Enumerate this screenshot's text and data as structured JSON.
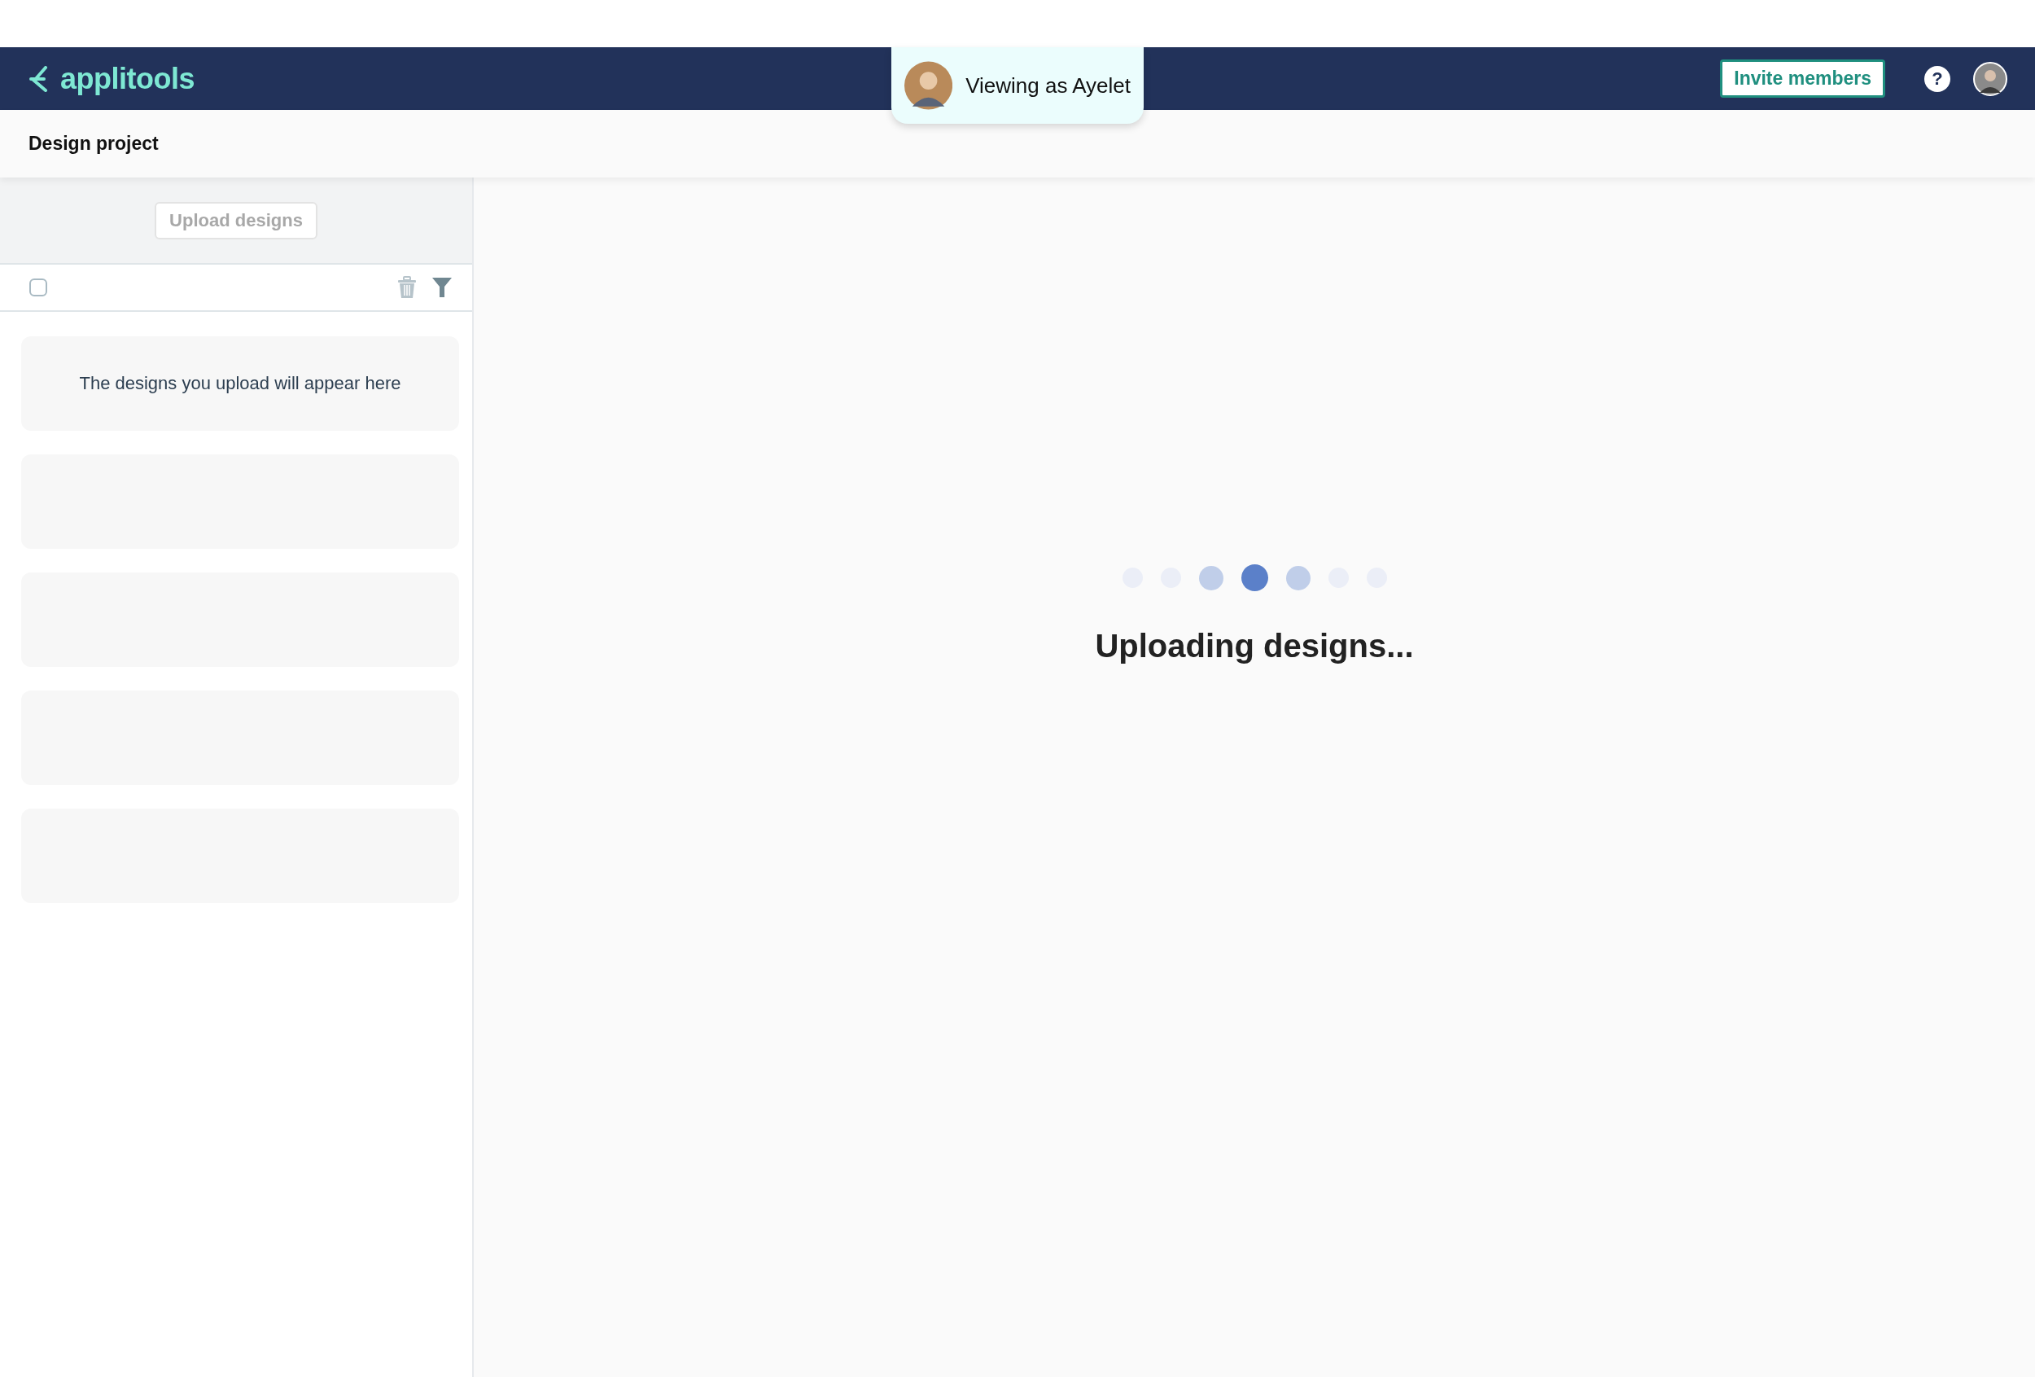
{
  "navbar": {
    "logo": "applitools",
    "viewing_badge": "Viewing as Ayelet",
    "invite_button": "Invite members",
    "help_icon": "?"
  },
  "page_title": "Design project",
  "sidebar": {
    "upload_button": {
      "label": "Upload designs",
      "disabled": true
    },
    "select_all": {
      "checked": false
    },
    "empty_message": "The designs you upload will appear here"
  },
  "loader": {
    "dots": [
      {
        "kind": "faint"
      },
      {
        "kind": "faint"
      },
      {
        "kind": "mid"
      },
      {
        "kind": "active"
      },
      {
        "kind": "mid"
      },
      {
        "kind": "faint"
      },
      {
        "kind": "faint"
      }
    ],
    "message": "Uploading designs..."
  }
}
